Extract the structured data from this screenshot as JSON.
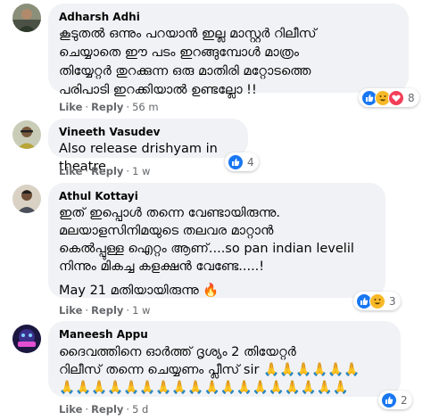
{
  "colors": {
    "like_blue": "#1877f2",
    "haha_yellow": "#f7b928",
    "love_red": "#f33e58",
    "bubble_bg": "#f0f2f5",
    "meta_gray": "#65676b"
  },
  "comments": [
    {
      "author": "Adharsh Adhi",
      "text": "കൂടുതൽ ഒന്നും പറയാൻ ഇല്ല മാസ്റ്റർ റിലീസ്\nചെയ്യാതെ ഈ പടം ഇറങ്ങുമ്പോൾ മാത്രം\nതിയ്യേറ്റർ തുറക്കുന്ന ഒരു മാതിരി മറ്റോടത്തെ\nപരിപാടി ഇറക്കിയാൽ ഉണ്ടല്ലോ !!",
      "like": "Like",
      "reply": "Reply",
      "time": "56 m",
      "reactions": [
        "like-icon",
        "haha-icon",
        "love-icon"
      ],
      "reaction_count": "8"
    },
    {
      "author": "Vineeth Vasudev",
      "text": "Also release drishyam in theatre",
      "like": "Like",
      "reply": "Reply",
      "time": "1 w",
      "reactions": [
        "like-icon"
      ],
      "reaction_count": "4"
    },
    {
      "author": "Athul Kottayi",
      "text": "ഇത് ഇപ്പൊൾ തന്നെ വേണ്ടായിരുന്നു.\nമലയാളസിനിമയുടെ തലവര മാറ്റാൻ\nകെൽപ്പുള്ള ഐറ്റം ആണ്....so pan indian levelil\nനിന്നും മികച്ച കളക്ഷൻ വേണ്ടേ.....!",
      "text2": "May 21 മതിയായിരുന്നു 🔥",
      "like": "Like",
      "reply": "Reply",
      "time": "1 w",
      "reactions": [
        "like-icon",
        "haha-icon"
      ],
      "reaction_count": "3"
    },
    {
      "author": "Maneesh Appu",
      "text": "ദൈവത്തിനെ ഓർത്ത് ദൃശ്യം 2 തിയേറ്റർ\nറിലീസ് തന്നെ ചെയ്യണം പ്ലീസ് sir 🙏🙏🙏🙏🙏🙏\n🙏🙏🙏🙏🙏🙏🙏🙏🙏🙏🙏🙏🙏🙏🙏🙏🙏🙏",
      "like": "Like",
      "reply": "Reply",
      "time": "5 d",
      "reactions": [
        "like-icon"
      ],
      "reaction_count": "2"
    }
  ]
}
